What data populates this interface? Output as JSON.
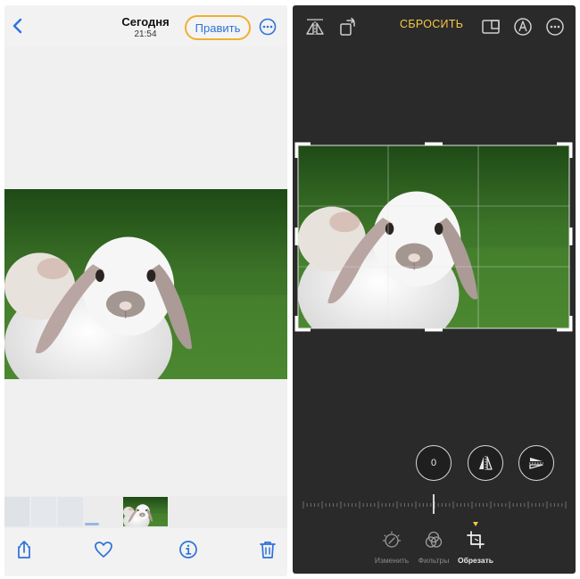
{
  "left": {
    "nav": {
      "title": "Сегодня",
      "subtitle": "21:54",
      "edit_label": "Править",
      "back_icon": "chevron-left-icon",
      "more_icon": "ellipsis-circle-icon"
    },
    "tabbar": {
      "icons": [
        "share-icon",
        "heart-icon",
        "info-icon",
        "trash-icon"
      ]
    }
  },
  "right": {
    "toolbar": {
      "reset_label": "СБРОСИТЬ",
      "icons": [
        "flip-horizontal-icon",
        "rotate-icon",
        "aspect-ratio-icon",
        "markup-icon",
        "ellipsis-circle-icon"
      ]
    },
    "adjust": {
      "value": "0",
      "icons": [
        "straighten-icon",
        "vertical-perspective-icon",
        "horizontal-perspective-icon"
      ]
    },
    "tabs": [
      {
        "label": "Изменить",
        "icon": "dial-icon",
        "active": false
      },
      {
        "label": "Фильтры",
        "icon": "filters-icon",
        "active": false
      },
      {
        "label": "Обрезать",
        "icon": "crop-icon",
        "active": true
      }
    ]
  },
  "colors": {
    "accent_blue": "#2d72d9",
    "highlight": "#f0b030",
    "reset_yellow": "#f6c945",
    "editor_bg": "#2a2a2a",
    "grass": "#3a6e26"
  }
}
